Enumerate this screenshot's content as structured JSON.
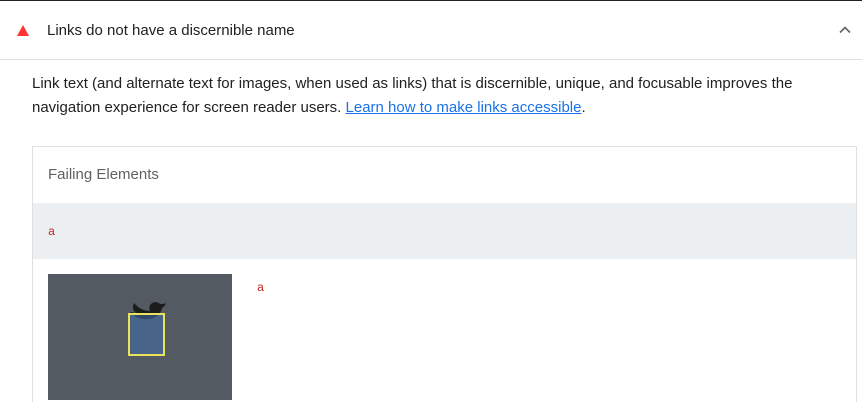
{
  "audit": {
    "title": "Links do not have a discernible name",
    "status_icon": "warning-triangle-icon",
    "status_color": "#ff3333",
    "expand_icon": "chevron-up-icon",
    "description_text": "Link text (and alternate text for images, when used as links) that is discernible, unique, and focusable improves the navigation experience for screen reader users. ",
    "learn_more_label": "Learn how to make links accessible",
    "description_suffix": "."
  },
  "table": {
    "header_label": "Failing Elements",
    "rows": [
      {
        "selector": "a",
        "highlighted": true
      },
      {
        "snippet": "a",
        "thumbnail_icon": "twitter-bird-icon"
      }
    ]
  },
  "colors": {
    "link": "#1a73e8",
    "code": "#c5221f",
    "row_highlight": "#eceff1",
    "thumbnail_bg": "#535a62",
    "element_highlight_border": "#e8e35a"
  }
}
